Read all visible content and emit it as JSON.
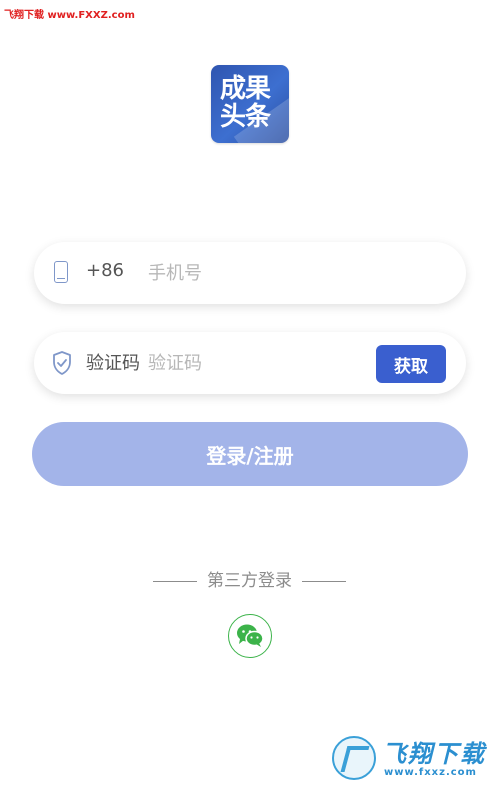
{
  "watermark": {
    "top_text": "飞翔下载 www.FXXZ.com",
    "bottom_title": "飞翔下载",
    "bottom_url": "www.fxxz.com"
  },
  "logo": {
    "line1": "成果",
    "line2": "头条"
  },
  "phone_field": {
    "country_code": "+86",
    "placeholder": "手机号",
    "value": ""
  },
  "code_field": {
    "label": "验证码",
    "placeholder": "验证码",
    "value": "",
    "get_button": "获取"
  },
  "login_button": "登录/注册",
  "third_party": {
    "label": "第三方登录"
  },
  "colors": {
    "accent": "#3a5fcf",
    "login_button_bg": "#a3b4e9",
    "wechat_green": "#3cb34a",
    "watermark_red": "#e02020"
  },
  "icons": {
    "phone": "phone-icon",
    "shield": "shield-check-icon",
    "wechat": "wechat-icon"
  }
}
